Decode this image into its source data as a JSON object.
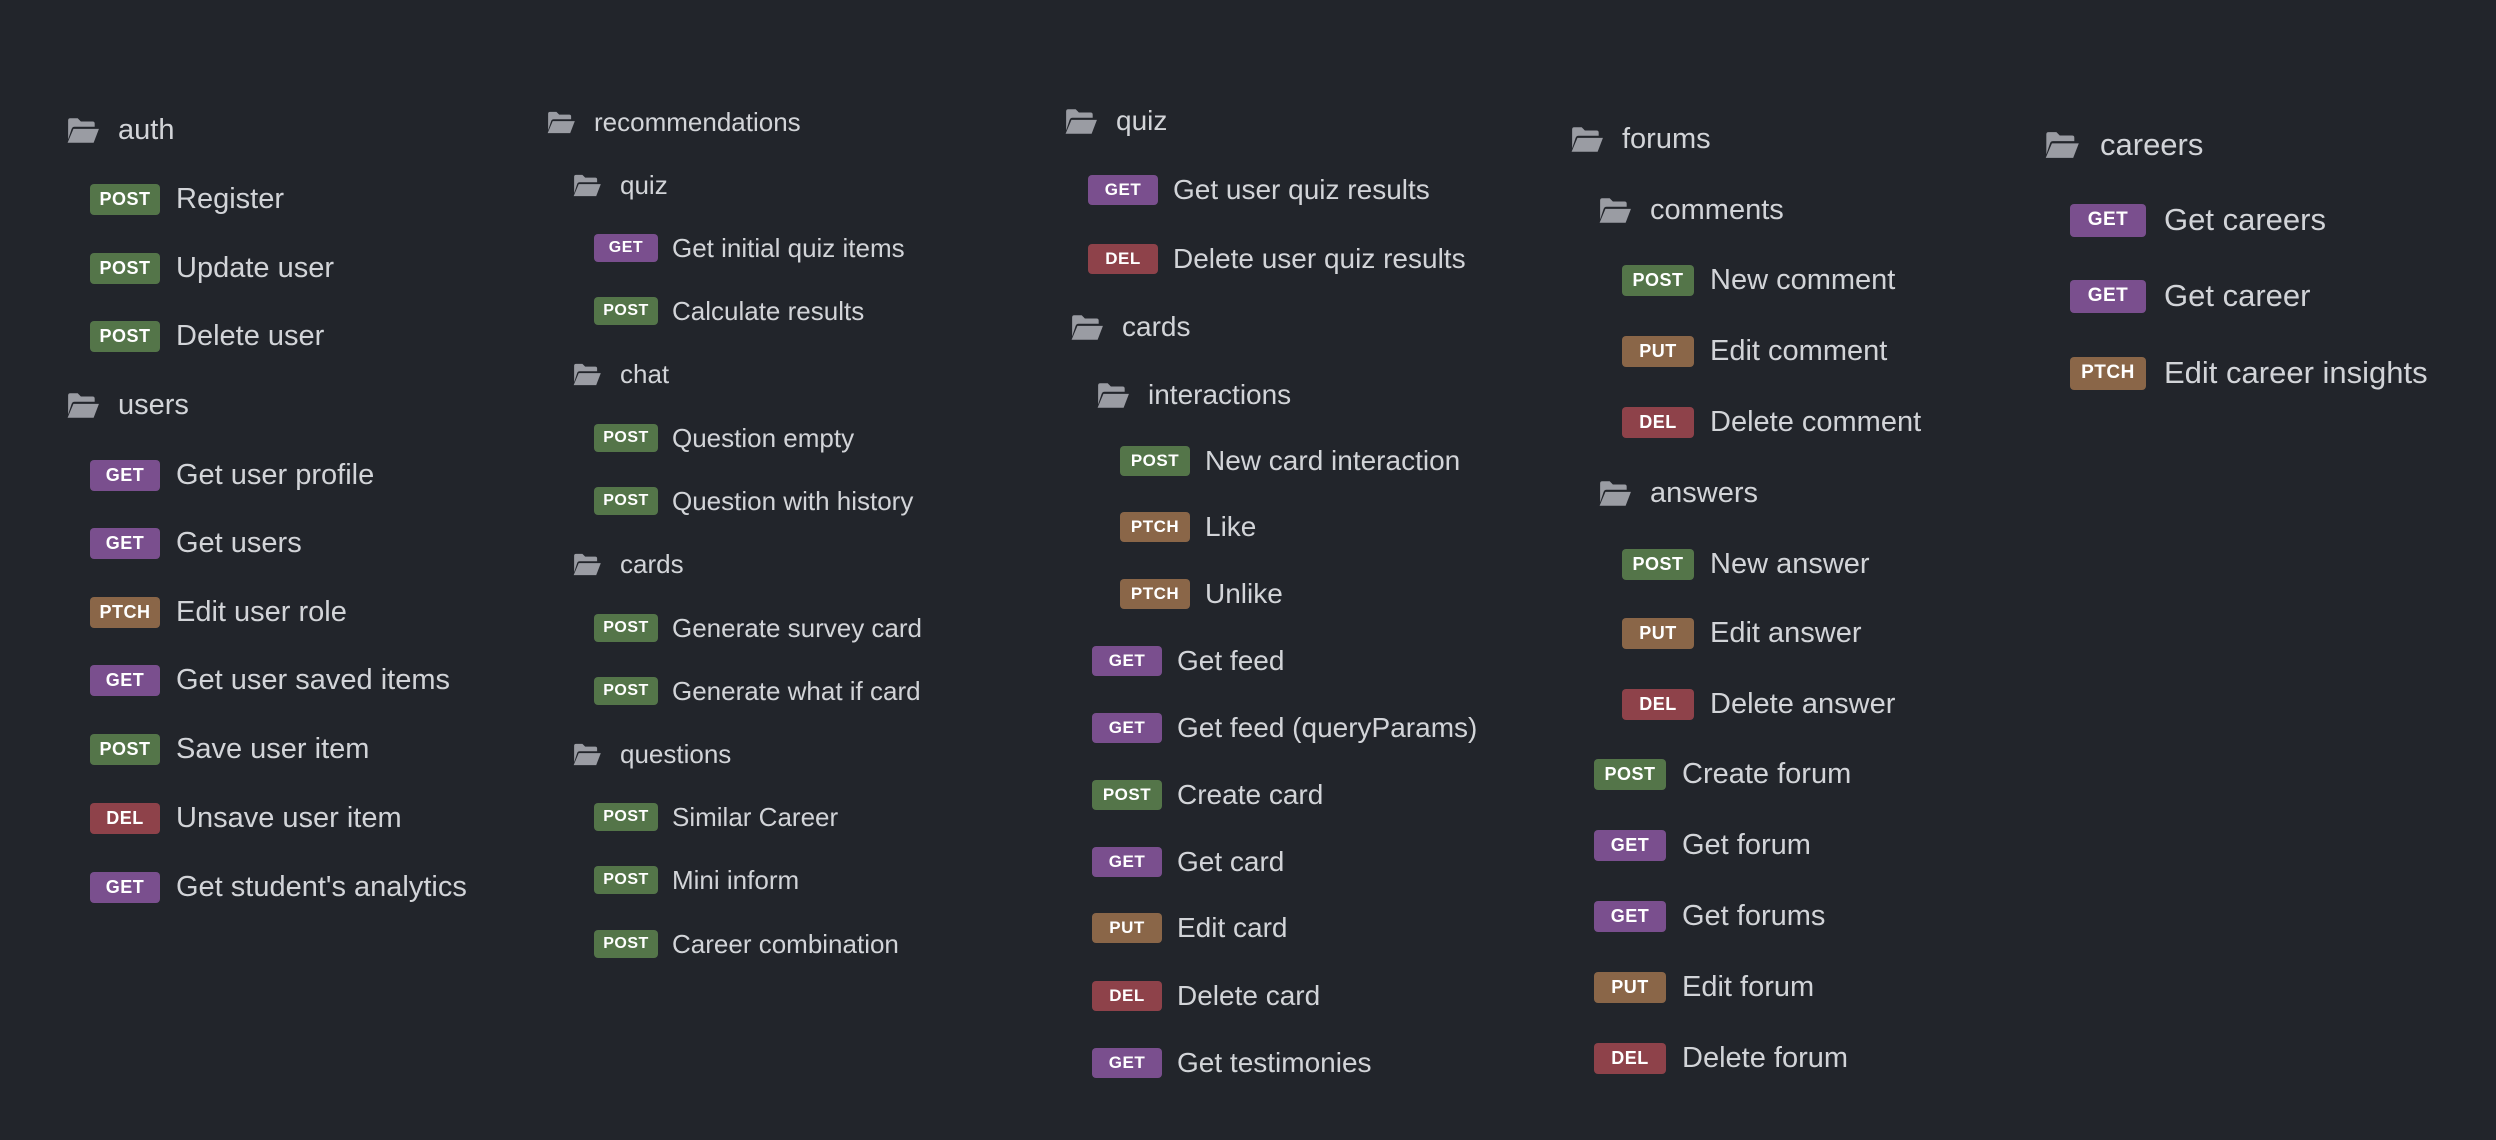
{
  "method_colors": {
    "GET": "#7a4f8e",
    "POST": "#547549",
    "PTCH": "#8a6648",
    "PUT": "#8a6648",
    "DEL": "#8e424a"
  },
  "columns": [
    {
      "name": "col-auth-users",
      "items": [
        {
          "kind": "folder",
          "label": "auth"
        },
        {
          "kind": "request",
          "method": "POST",
          "label": "Register"
        },
        {
          "kind": "request",
          "method": "POST",
          "label": "Update user"
        },
        {
          "kind": "request",
          "method": "POST",
          "label": "Delete user"
        },
        {
          "kind": "folder",
          "label": "users"
        },
        {
          "kind": "request",
          "method": "GET",
          "label": "Get user profile"
        },
        {
          "kind": "request",
          "method": "GET",
          "label": "Get users"
        },
        {
          "kind": "request",
          "method": "PTCH",
          "label": "Edit user role"
        },
        {
          "kind": "request",
          "method": "GET",
          "label": "Get user saved items"
        },
        {
          "kind": "request",
          "method": "POST",
          "label": "Save user item"
        },
        {
          "kind": "request",
          "method": "DEL",
          "label": "Unsave user item"
        },
        {
          "kind": "request",
          "method": "GET",
          "label": "Get student's analytics"
        }
      ]
    },
    {
      "name": "col-recommendations",
      "items": [
        {
          "kind": "folder",
          "label": "recommendations"
        },
        {
          "kind": "folder",
          "label": "quiz"
        },
        {
          "kind": "request",
          "method": "GET",
          "label": "Get initial quiz items"
        },
        {
          "kind": "request",
          "method": "POST",
          "label": "Calculate results"
        },
        {
          "kind": "folder",
          "label": "chat"
        },
        {
          "kind": "request",
          "method": "POST",
          "label": "Question empty"
        },
        {
          "kind": "request",
          "method": "POST",
          "label": "Question with history"
        },
        {
          "kind": "folder",
          "label": "cards"
        },
        {
          "kind": "request",
          "method": "POST",
          "label": "Generate survey card"
        },
        {
          "kind": "request",
          "method": "POST",
          "label": "Generate what if card"
        },
        {
          "kind": "folder",
          "label": "questions"
        },
        {
          "kind": "request",
          "method": "POST",
          "label": "Similar Career"
        },
        {
          "kind": "request",
          "method": "POST",
          "label": "Mini inform"
        },
        {
          "kind": "request",
          "method": "POST",
          "label": "Career combination"
        }
      ]
    },
    {
      "name": "col-quiz-cards",
      "items": [
        {
          "kind": "folder",
          "label": "quiz"
        },
        {
          "kind": "request",
          "method": "GET",
          "label": "Get user quiz results"
        },
        {
          "kind": "request",
          "method": "DEL",
          "label": "Delete user quiz results"
        },
        {
          "kind": "folder",
          "label": "cards"
        },
        {
          "kind": "folder",
          "label": "interactions"
        },
        {
          "kind": "request",
          "method": "POST",
          "label": "New card interaction"
        },
        {
          "kind": "request",
          "method": "PTCH",
          "label": "Like"
        },
        {
          "kind": "request",
          "method": "PTCH",
          "label": "Unlike"
        },
        {
          "kind": "request",
          "method": "GET",
          "label": "Get feed"
        },
        {
          "kind": "request",
          "method": "GET",
          "label": "Get feed (queryParams)"
        },
        {
          "kind": "request",
          "method": "POST",
          "label": "Create card"
        },
        {
          "kind": "request",
          "method": "GET",
          "label": "Get card"
        },
        {
          "kind": "request",
          "method": "PUT",
          "label": "Edit card"
        },
        {
          "kind": "request",
          "method": "DEL",
          "label": "Delete card"
        },
        {
          "kind": "request",
          "method": "GET",
          "label": "Get testimonies"
        }
      ]
    },
    {
      "name": "col-forums",
      "items": [
        {
          "kind": "folder",
          "label": "forums"
        },
        {
          "kind": "folder",
          "label": "comments"
        },
        {
          "kind": "request",
          "method": "POST",
          "label": "New comment"
        },
        {
          "kind": "request",
          "method": "PUT",
          "label": "Edit comment"
        },
        {
          "kind": "request",
          "method": "DEL",
          "label": "Delete comment"
        },
        {
          "kind": "folder",
          "label": "answers"
        },
        {
          "kind": "request",
          "method": "POST",
          "label": "New answer"
        },
        {
          "kind": "request",
          "method": "PUT",
          "label": "Edit answer"
        },
        {
          "kind": "request",
          "method": "DEL",
          "label": "Delete answer"
        },
        {
          "kind": "request",
          "method": "POST",
          "label": "Create forum"
        },
        {
          "kind": "request",
          "method": "GET",
          "label": "Get forum"
        },
        {
          "kind": "request",
          "method": "GET",
          "label": "Get forums"
        },
        {
          "kind": "request",
          "method": "PUT",
          "label": "Edit forum"
        },
        {
          "kind": "request",
          "method": "DEL",
          "label": "Delete forum"
        }
      ]
    },
    {
      "name": "col-careers",
      "items": [
        {
          "kind": "folder",
          "label": "careers"
        },
        {
          "kind": "request",
          "method": "GET",
          "label": "Get careers"
        },
        {
          "kind": "request",
          "method": "GET",
          "label": "Get career"
        },
        {
          "kind": "request",
          "method": "PTCH",
          "label": "Edit career insights"
        }
      ]
    }
  ]
}
